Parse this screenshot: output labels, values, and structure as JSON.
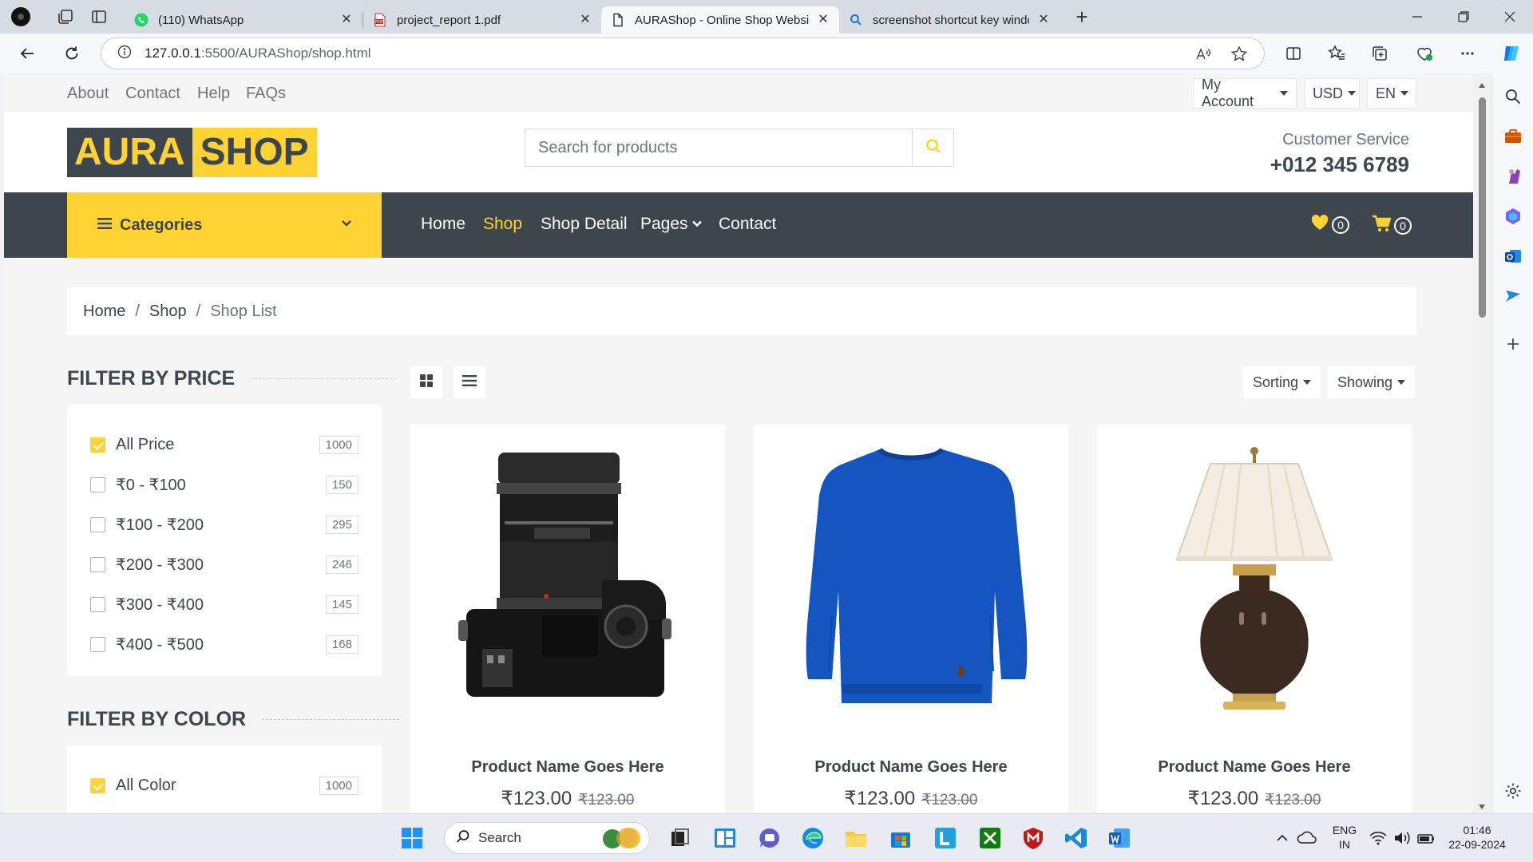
{
  "browser": {
    "tabs": [
      {
        "title": "(110) WhatsApp",
        "icon": "whatsapp-icon"
      },
      {
        "title": "project_report 1.pdf",
        "icon": "pdf-icon"
      },
      {
        "title": "AURAShop - Online Shop Website",
        "icon": "page-icon",
        "active": true
      },
      {
        "title": "screenshot shortcut key windows",
        "icon": "search-icon"
      }
    ],
    "url_host": "127.0.0.1",
    "url_path": ":5500/AURAShop/shop.html"
  },
  "topbar": {
    "links": [
      "About",
      "Contact",
      "Help",
      "FAQs"
    ],
    "account": "My Account",
    "currency": "USD",
    "language": "EN"
  },
  "header": {
    "logo_part1": "AURA",
    "logo_part2": "SHOP",
    "search_placeholder": "Search for products",
    "cs_label": "Customer Service",
    "cs_phone": "+012 345 6789"
  },
  "nav": {
    "categories_label": "Categories",
    "links": [
      "Home",
      "Shop",
      "Shop Detail",
      "Pages",
      "Contact"
    ],
    "active": "Shop",
    "wishlist_count": "0",
    "cart_count": "0"
  },
  "breadcrumb": {
    "items": [
      "Home",
      "Shop"
    ],
    "current": "Shop List"
  },
  "filters": {
    "price_title": "Filter by price",
    "price": [
      {
        "label": "All Price",
        "count": "1000",
        "checked": true
      },
      {
        "label": "₹0 - ₹100",
        "count": "150",
        "checked": false
      },
      {
        "label": "₹100 - ₹200",
        "count": "295",
        "checked": false
      },
      {
        "label": "₹200 - ₹300",
        "count": "246",
        "checked": false
      },
      {
        "label": "₹300 - ₹400",
        "count": "145",
        "checked": false
      },
      {
        "label": "₹400 - ₹500",
        "count": "168",
        "checked": false
      }
    ],
    "color_title": "Filter by color",
    "color": [
      {
        "label": "All Color",
        "count": "1000",
        "checked": true
      }
    ]
  },
  "toolbar": {
    "sorting": "Sorting",
    "showing": "Showing"
  },
  "products": [
    {
      "name": "Product Name Goes Here",
      "price": "₹123.00",
      "old_price": "₹123.00",
      "image": "camera"
    },
    {
      "name": "Product Name Goes Here",
      "price": "₹123.00",
      "old_price": "₹123.00",
      "image": "sweater"
    },
    {
      "name": "Product Name Goes Here",
      "price": "₹123.00",
      "old_price": "₹123.00",
      "image": "lamp"
    }
  ],
  "taskbar": {
    "search": "Search",
    "lang1": "ENG",
    "lang2": "IN",
    "time": "01:46",
    "date": "22-09-2024"
  },
  "colors": {
    "accent": "#ffd333",
    "dark": "#3d464d"
  }
}
